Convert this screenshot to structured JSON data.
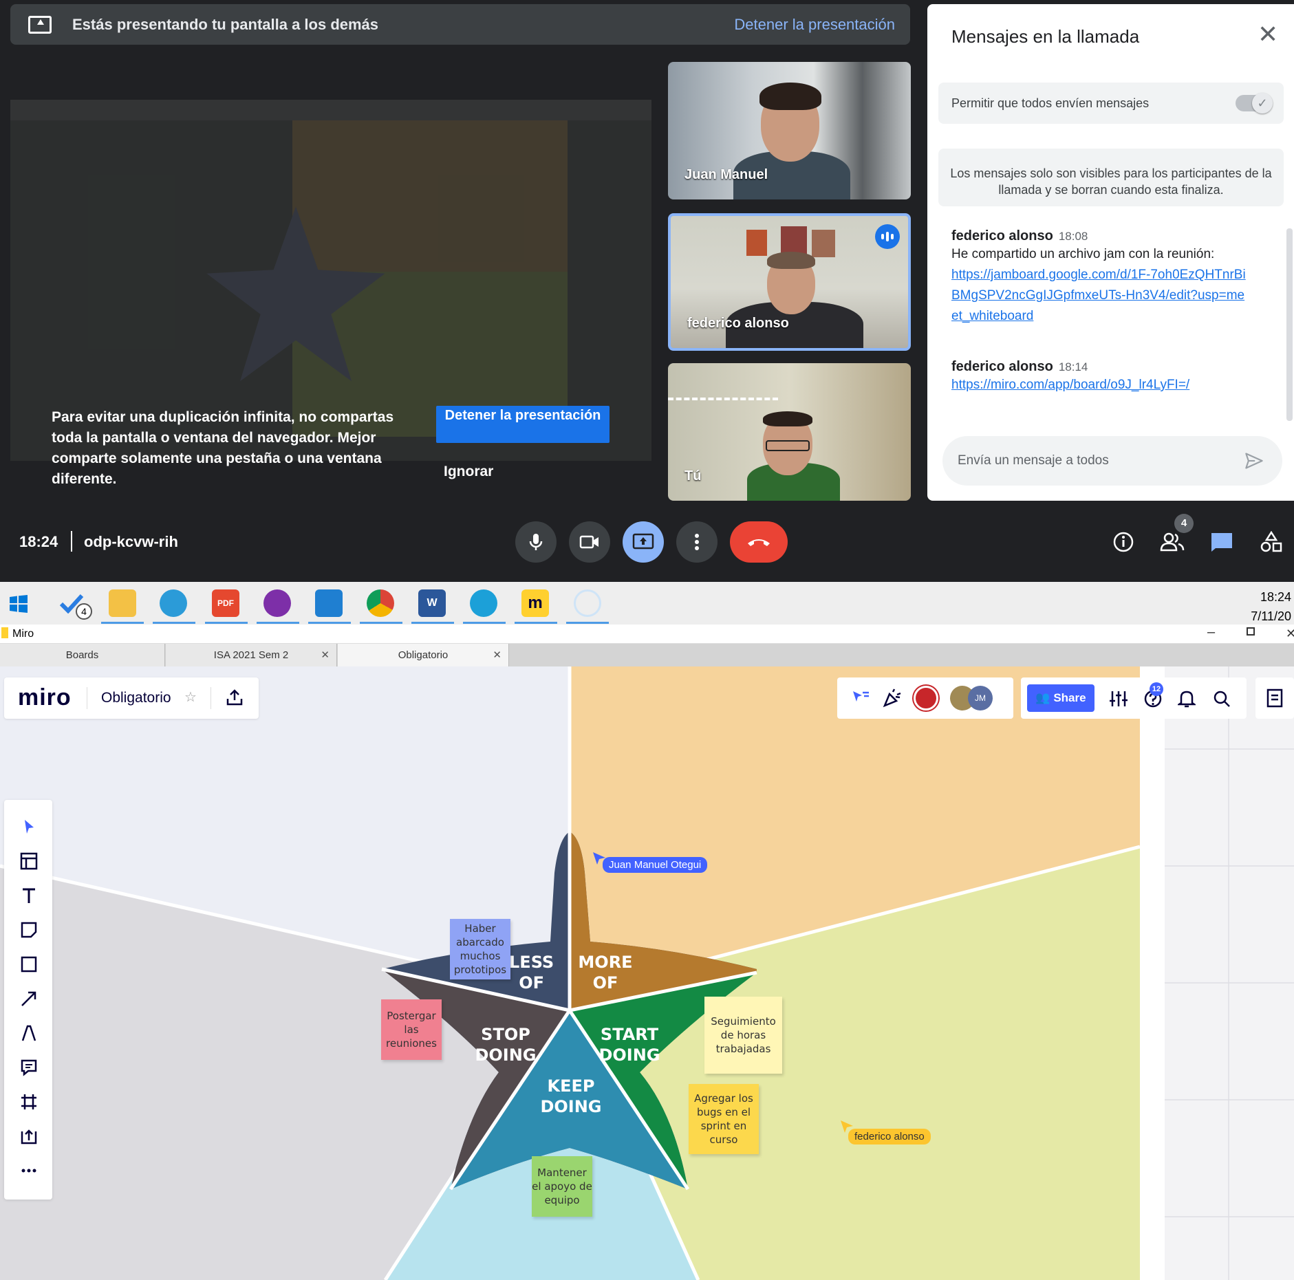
{
  "meet": {
    "banner_text": "Estás presentando tu pantalla a los demás",
    "banner_stop": "Detener la presentación",
    "warning": "Para evitar una duplicación infinita, no compartas toda la pantalla o ventana del navegador. Mejor comparte solamente una pestaña o una ventana diferente.",
    "stop_button": "Detener la presentación",
    "ignore_button": "Ignorar",
    "participants": [
      {
        "name": "Juan Manuel"
      },
      {
        "name": "federico alonso"
      },
      {
        "name": "Tú"
      }
    ],
    "time": "18:24",
    "meeting_code": "odp-kcvw-rih",
    "people_count": "4"
  },
  "chat": {
    "title": "Mensajes en la llamada",
    "allow_label": "Permitir que todos envíen mensajes",
    "allow_enabled": true,
    "info": "Los mensajes solo son visibles para los participantes de la llamada y se borran cuando esta finaliza.",
    "messages": [
      {
        "sender": "federico alonso",
        "time": "18:08",
        "text": "He compartido un archivo jam con la reunión:",
        "link": "https://jamboard.google.com/d/1F-7oh0EzQHTnrBiBMgSPV2ncGgIJGpfmxeUTs-Hn3V4/edit?usp=meet_whiteboard"
      },
      {
        "sender": "federico alonso",
        "time": "18:14",
        "text": "",
        "link": "https://miro.com/app/board/o9J_lr4LyFI=/"
      }
    ],
    "input_placeholder": "Envía un mensaje a todos"
  },
  "taskbar": {
    "todo_badge": "4",
    "clock_time": "18:24",
    "clock_date": "7/11/20"
  },
  "browser": {
    "window_title": "Miro",
    "tabs": [
      {
        "label": "Boards"
      },
      {
        "label": "ISA 2021 Sem 2"
      },
      {
        "label": "Obligatorio"
      }
    ]
  },
  "miro": {
    "logo": "miro",
    "board_name": "Obligatorio",
    "share_label": "Share",
    "help_badge": "12",
    "avatar_initials": "JM",
    "star_sections": [
      {
        "label": "LESS OF",
        "color": "#3d4d6b"
      },
      {
        "label": "MORE OF",
        "color": "#b57a2e"
      },
      {
        "label": "START DOING",
        "color": "#138a44"
      },
      {
        "label": "KEEP DOING",
        "color": "#2e8db0"
      },
      {
        "label": "STOP DOING",
        "color": "#534a4d"
      }
    ],
    "stickies": [
      {
        "text": "Haber abarcado muchos prototipos",
        "color": "#8fa3f5"
      },
      {
        "text": "Postergar las reuniones",
        "color": "#f08090"
      },
      {
        "text": "Seguimiento de horas trabajadas",
        "color": "#fff6b6"
      },
      {
        "text": "Agregar los bugs en el sprint en curso",
        "color": "#fcd84c"
      },
      {
        "text": "Mantener el apoyo de equipo",
        "color": "#9ad56f"
      }
    ],
    "cursors": [
      {
        "name": "Juan Manuel Otegui",
        "color": "#4262ff"
      },
      {
        "name": "federico alonso",
        "color": "#fcc52e"
      }
    ]
  }
}
